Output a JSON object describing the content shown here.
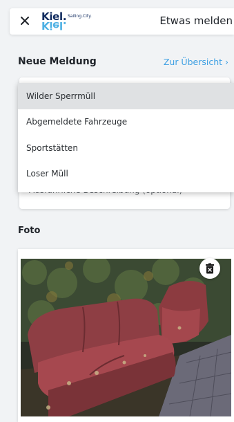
{
  "header": {
    "title": "Etwas melden",
    "logo": {
      "word": "Kiel.",
      "tagline": "Sailing.City."
    }
  },
  "report": {
    "heading": "Neue Meldung",
    "overview_link": "Zur Übersicht ›",
    "description_placeholder": "Ausführliche Beschreibung (optional)"
  },
  "dropdown": {
    "options": [
      {
        "label": "Wilder Sperrmüll",
        "selected": true
      },
      {
        "label": "Abgemeldete Fahrzeuge",
        "selected": false
      },
      {
        "label": "Sportstätten",
        "selected": false
      },
      {
        "label": "Loser Müll",
        "selected": false
      }
    ]
  },
  "photo": {
    "heading": "Foto"
  },
  "colors": {
    "accent": "#3ea0e3",
    "brand_dark": "#0f2a5e",
    "selected_option": "#dfe1e3",
    "background": "#f1f3f5"
  },
  "icons": {
    "close": "close-icon",
    "delete": "trash-icon"
  }
}
